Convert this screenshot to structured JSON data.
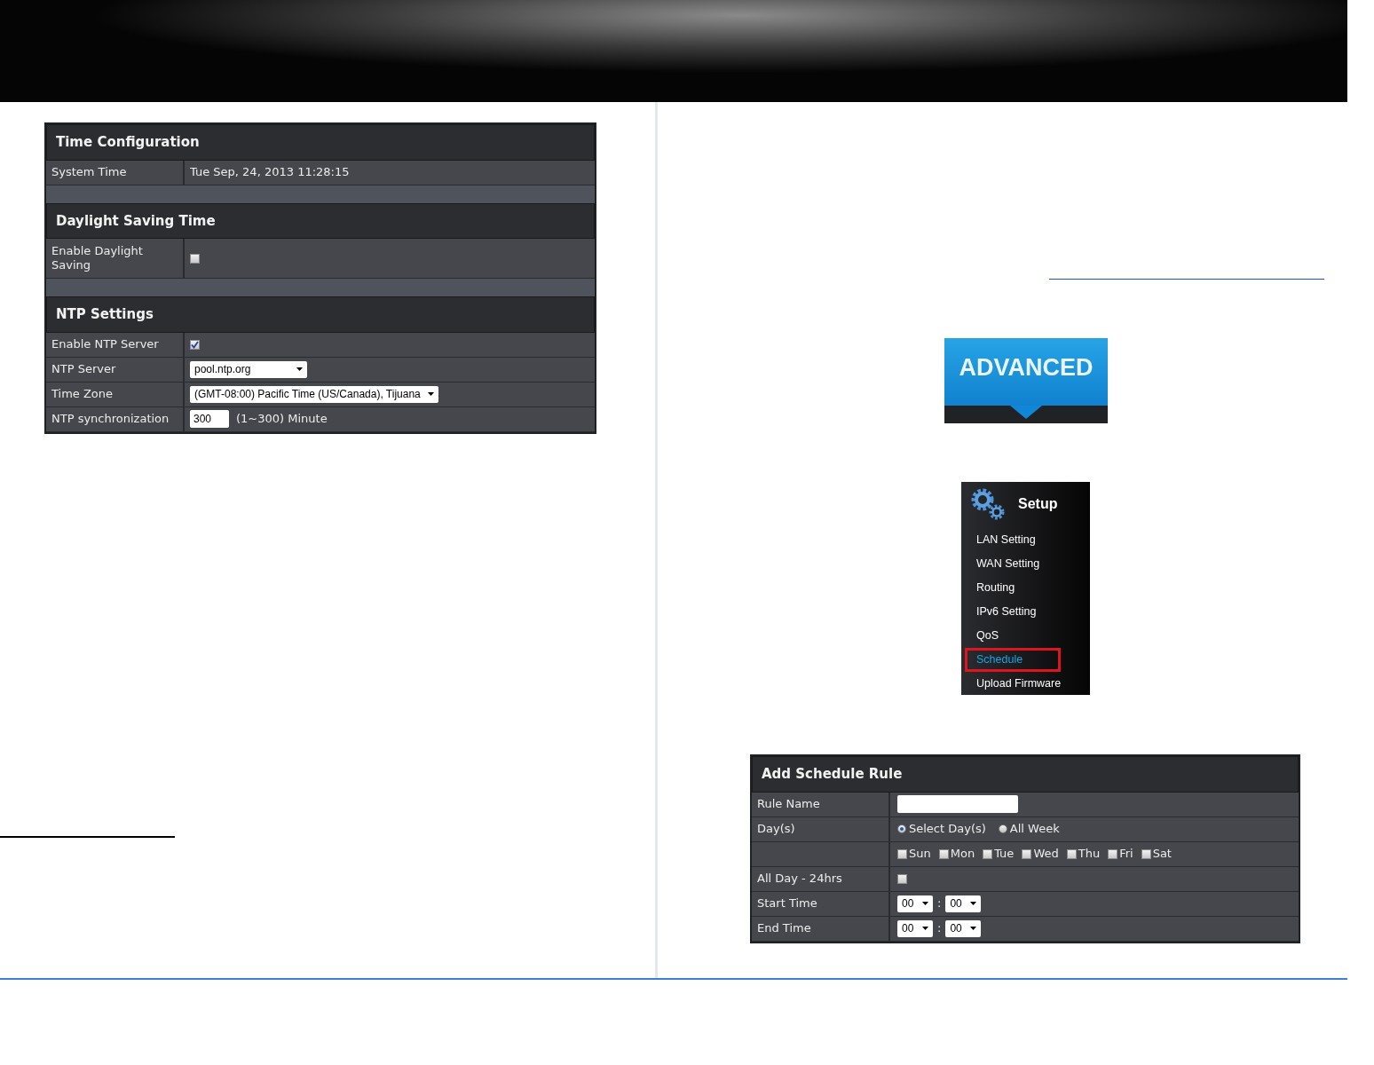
{
  "time_config": {
    "title": "Time Configuration",
    "rows": [
      {
        "label": "System Time",
        "value": "Tue Sep, 24, 2013 11:28:15"
      }
    ]
  },
  "daylight": {
    "title": "Daylight Saving Time",
    "rows": [
      {
        "kind": "checkbox",
        "label": "Enable Daylight Saving",
        "checked": false
      }
    ]
  },
  "ntp": {
    "title": "NTP Settings",
    "rows": [
      {
        "kind": "checkbox",
        "label": "Enable NTP Server",
        "checked": true
      },
      {
        "kind": "select",
        "label": "NTP Server",
        "value": "pool.ntp.org"
      },
      {
        "kind": "select",
        "label": "Time Zone",
        "value": "(GMT-08:00) Pacific Time (US/Canada), Tijuana"
      },
      {
        "kind": "input",
        "label": "NTP synchronization",
        "value": "300",
        "hint": "(1~300) Minute"
      }
    ]
  },
  "advanced_button": {
    "label": "ADVANCED"
  },
  "setup_menu": {
    "title": "Setup",
    "items": [
      {
        "label": "LAN Setting",
        "selected": false
      },
      {
        "label": "WAN Setting",
        "selected": false
      },
      {
        "label": "Routing",
        "selected": false
      },
      {
        "label": "IPv6 Setting",
        "selected": false
      },
      {
        "label": "QoS",
        "selected": false
      },
      {
        "label": "Schedule",
        "selected": true
      },
      {
        "label": "Upload Firmware",
        "selected": false
      }
    ]
  },
  "schedule": {
    "title": "Add Schedule Rule",
    "rule_name": {
      "label": "Rule Name"
    },
    "days": {
      "label": "Day(s)",
      "options": [
        {
          "label": "Select Day(s)",
          "selected": true
        },
        {
          "label": "All Week",
          "selected": false
        }
      ]
    },
    "weekdays": [
      {
        "label": "Sun",
        "checked": false
      },
      {
        "label": "Mon",
        "checked": false
      },
      {
        "label": "Tue",
        "checked": false
      },
      {
        "label": "Wed",
        "checked": false
      },
      {
        "label": "Thu",
        "checked": false
      },
      {
        "label": "Fri",
        "checked": false
      },
      {
        "label": "Sat",
        "checked": false
      }
    ],
    "all_day": {
      "label": "All Day - 24hrs",
      "checked": false
    },
    "times": [
      {
        "label": "Start Time",
        "hour": "00",
        "separator": ":",
        "minute": "00"
      },
      {
        "label": "End Time",
        "hour": "00",
        "separator": ":",
        "minute": "00"
      }
    ]
  }
}
